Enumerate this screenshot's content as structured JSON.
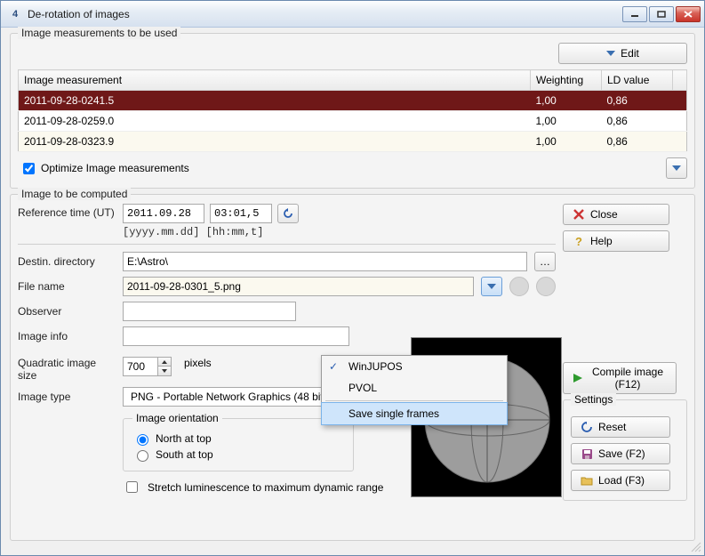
{
  "window": {
    "title": "De-rotation of images"
  },
  "group1": {
    "title": "Image measurements to be used",
    "edit_label": "Edit",
    "headers": {
      "c1": "Image measurement",
      "c2": "Weighting",
      "c3": "LD value"
    },
    "rows": [
      {
        "name": "2011-09-28-0241.5",
        "weight": "1,00",
        "ld": "0,86",
        "selected": true
      },
      {
        "name": "2011-09-28-0259.0",
        "weight": "1,00",
        "ld": "0,86",
        "selected": false
      },
      {
        "name": "2011-09-28-0323.9",
        "weight": "1,00",
        "ld": "0,86",
        "selected": false
      }
    ],
    "optimize_label": "Optimize Image measurements"
  },
  "group2": {
    "title": "Image to be computed",
    "ref_time_label": "Reference time (UT)",
    "ref_date": "2011.09.28",
    "ref_time": "03:01,5",
    "ref_fmt": "[yyyy.mm.dd] [hh:mm,t]",
    "dest_label": "Destin. directory",
    "dest_value": "E:\\Astro\\",
    "file_label": "File name",
    "file_value": "2011-09-28-0301_5.png",
    "observer_label": "Observer",
    "observer_value": "",
    "info_label": "Image info",
    "info_value": "",
    "quad_label": "Quadratic image size",
    "quad_value": "700",
    "quad_unit": "pixels",
    "type_label": "Image type",
    "type_value": "PNG  - Portable Network Graphics (48 bit)",
    "orient_title": "Image orientation",
    "orient_north": "North at top",
    "orient_south": "South at top",
    "stretch_label": "Stretch luminescence to maximum dynamic range"
  },
  "dropdown": {
    "items": [
      {
        "label": "WinJUPOS",
        "checked": true
      },
      {
        "label": "PVOL",
        "checked": false
      }
    ],
    "save_frames": "Save single frames"
  },
  "side": {
    "close": "Close",
    "help": "Help",
    "compile": "Compile image (F12)",
    "settings_title": "Settings",
    "reset": "Reset",
    "save": "Save (F2)",
    "load": "Load (F3)"
  }
}
